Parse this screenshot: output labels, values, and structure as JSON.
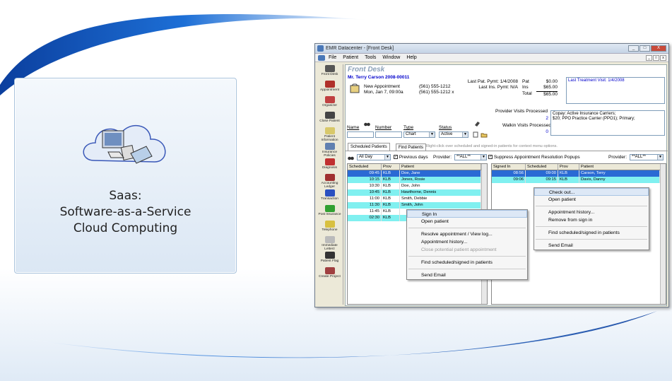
{
  "slide": {
    "card_text": [
      "Saas:",
      "Software-as-a-Service",
      "Cloud Computing"
    ],
    "accent_blue": "#1d6fd6"
  },
  "window": {
    "title": "EMR Datacenter - [Front Desk]",
    "min": "_",
    "max": "□",
    "close": "X",
    "menu": [
      "File",
      "Patient",
      "Tools",
      "Window",
      "Help"
    ],
    "mdi": [
      "_",
      "□",
      "x"
    ]
  },
  "sidebar": [
    {
      "label": "Front Desk",
      "icon": "front-desk-icon",
      "color": "#555"
    },
    {
      "label": "Appointment",
      "icon": "appointment-icon",
      "color": "#b0302a"
    },
    {
      "label": "Organizer",
      "icon": "organizer-icon",
      "color": "#c04040"
    },
    {
      "label": "Close Patient",
      "icon": "close-patient-icon",
      "color": "#444"
    },
    {
      "label": "Patient Information",
      "icon": "patient-info-icon",
      "color": "#d8c86a"
    },
    {
      "label": "Insurance Policies",
      "icon": "insurance-icon",
      "color": "#6080b0"
    },
    {
      "label": "Diagnosis",
      "icon": "diagnosis-icon",
      "color": "#c03030"
    },
    {
      "label": "Accounting Ledger",
      "icon": "ledger-icon",
      "color": "#a03030"
    },
    {
      "label": "Transaction",
      "icon": "transaction-icon",
      "color": "#2a50c0"
    },
    {
      "label": "Post Insurance",
      "icon": "post-insurance-icon",
      "color": "#30a030"
    },
    {
      "label": "Telephone",
      "icon": "telephone-icon",
      "color": "#d8c040"
    },
    {
      "label": "Immediate Letterz",
      "icon": "letter-icon",
      "color": "#bbb"
    },
    {
      "label": "Patient Flag",
      "icon": "flag-icon",
      "color": "#333"
    },
    {
      "label": "Create Project",
      "icon": "project-icon",
      "color": "#a04040"
    }
  ],
  "frontdesk": {
    "title": "Front Desk",
    "patient_name": "Mr. Terry Carson 2008-00011",
    "appt_label": "New Appointment",
    "appt_time": "Mon, Jan 7, 09:00a",
    "phone1": "(561) 555-1212",
    "phone2": "(561) 555-1212 x",
    "last_pat_pymt": "Last Pat. Pymt: 1/4/2008",
    "last_ins_pymt": "Last Ins. Pymt: N/A",
    "pat_label": "Pat",
    "pat_val": "$0.00",
    "ins_label": "Ins",
    "ins_val": "$65.00",
    "total_label": "Total",
    "total_val": "$65.00",
    "last_treatment": "Last Treatment Visit: 1/4/2008",
    "provider_visits_label": "Provider Visits Processed",
    "provider_visits_val": "2",
    "walkin_label": "Walkin Visits Processed",
    "walkin_val": "0",
    "copay": "Copay: Active Insurance Carriers;",
    "copay2": "$20; PPO Practice Carrier (PPO1); Primary;",
    "search": {
      "name_label": "Name",
      "number_label": "Number",
      "type_label": "Type",
      "type_value": "Chart",
      "status_label": "Status",
      "status_value": "Active"
    },
    "tabs": [
      "Scheduled Patients",
      "Find Patients"
    ],
    "tab_hint": "Right-click over scheduled and signed-in patients for context menu options.",
    "filter": {
      "range_value": "All Day",
      "prev_days_label": "Previous days",
      "provider_label": "Provider:",
      "provider_value": "**ALL**",
      "suppress_label": "Suppress Appointment Resolution Popups",
      "provider2_label": "Provider:",
      "provider2_value": "**ALL**"
    },
    "scheduled": {
      "headers": [
        "Scheduled",
        "Prov",
        "Patient"
      ],
      "rows": [
        {
          "time": "09:45",
          "prov": "KLB",
          "patient": "Doe, Jane",
          "style": "blue"
        },
        {
          "time": "10:15",
          "prov": "KLB",
          "patient": "Jones, Rosie",
          "style": "cyan"
        },
        {
          "time": "10:30",
          "prov": "KLB",
          "patient": "Doe, John",
          "style": "none"
        },
        {
          "time": "10:45",
          "prov": "KLB",
          "patient": "Hawthorne, Dennis",
          "style": "cyan"
        },
        {
          "time": "11:00",
          "prov": "KLB",
          "patient": "Smith, Debbie",
          "style": "none"
        },
        {
          "time": "11:30",
          "prov": "KLB",
          "patient": "Smith, John",
          "style": "cyan"
        },
        {
          "time": "11:45",
          "prov": "KLB",
          "patient": "",
          "style": "none"
        },
        {
          "time": "02:30",
          "prov": "KLB",
          "patient": "",
          "style": "cyan"
        }
      ]
    },
    "signed": {
      "headers": [
        "Signed In",
        "Scheduled",
        "Prov",
        "Patient"
      ],
      "rows": [
        {
          "signed": "08:56",
          "sched": "09:00",
          "prov": "KLB",
          "patient": "Carson, Terry",
          "style": "blue"
        },
        {
          "signed": "09:06",
          "sched": "09:15",
          "prov": "KLB",
          "patient": "Davis, Danny",
          "style": "cyan"
        }
      ]
    },
    "ctx_left": [
      "Sign In",
      "Open patient",
      "-",
      "Resolve appointment / View log...",
      "Appointment history...",
      "Close potential patient appointment",
      "-",
      "Find scheduled/signed in patients",
      "-",
      "Send Email"
    ],
    "ctx_right": [
      "Check out...",
      "Open patient",
      "-",
      "Appointment history...",
      "Remove from sign in",
      "-",
      "Find scheduled/signed in patients",
      "-",
      "Send Email"
    ]
  }
}
